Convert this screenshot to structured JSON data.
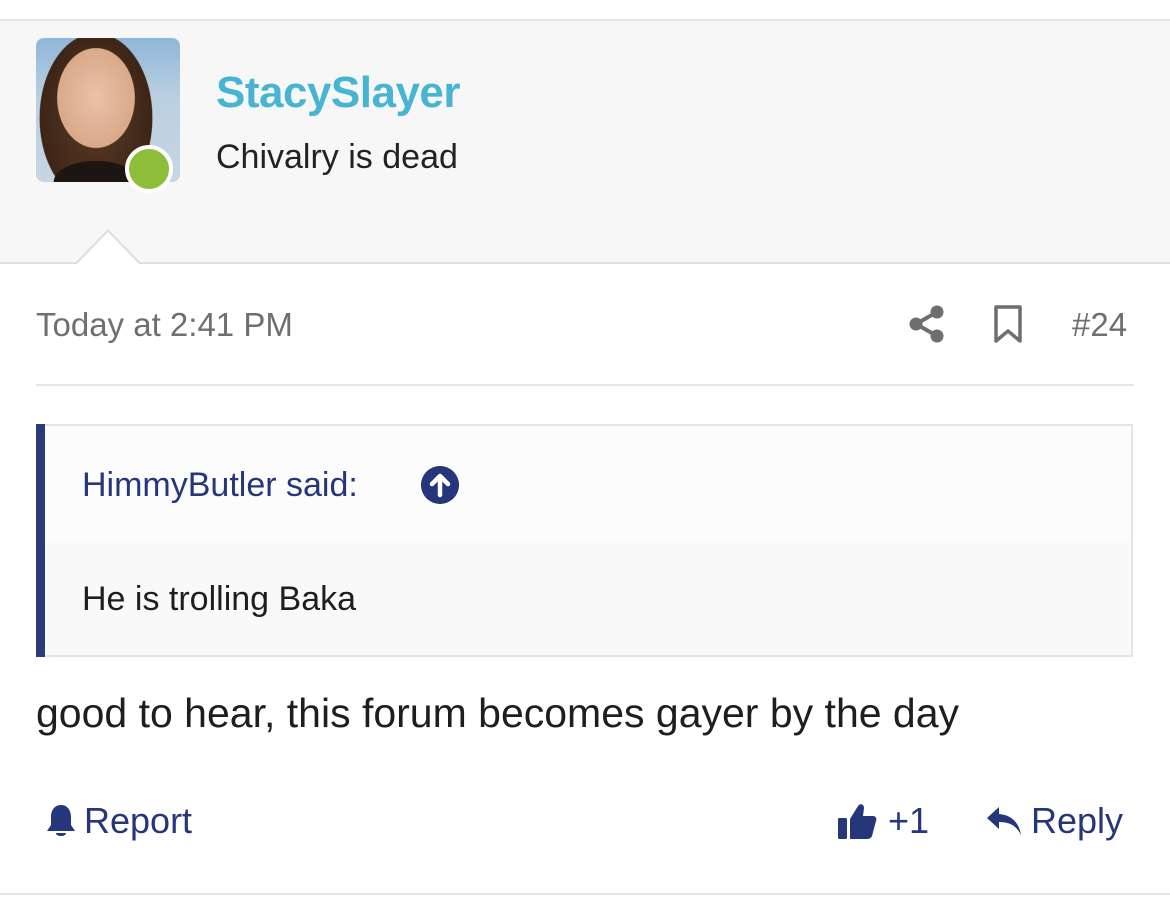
{
  "author": {
    "username": "StacySlayer",
    "title": "Chivalry is dead",
    "status": "online",
    "username_color": "#47b5d1",
    "online_color": "#8cbe3a"
  },
  "post": {
    "date": "Today at 2:41 PM",
    "number": "#24",
    "body": "good to hear, this forum becomes gayer by the day"
  },
  "quote": {
    "author_line": "HimmyButler said:",
    "text": "He is trolling Baka",
    "accent_color": "#2b3a79"
  },
  "icons": {
    "share": "share-icon",
    "bookmark": "bookmark-icon",
    "quote_jump": "arrow-up-circle-icon",
    "report": "bell-icon",
    "like": "thumbs-up-icon",
    "reply": "reply-arrow-icon"
  },
  "actions": {
    "report_label": "Report",
    "like_label": "+1",
    "reply_label": "Reply",
    "link_color": "#26367a"
  }
}
